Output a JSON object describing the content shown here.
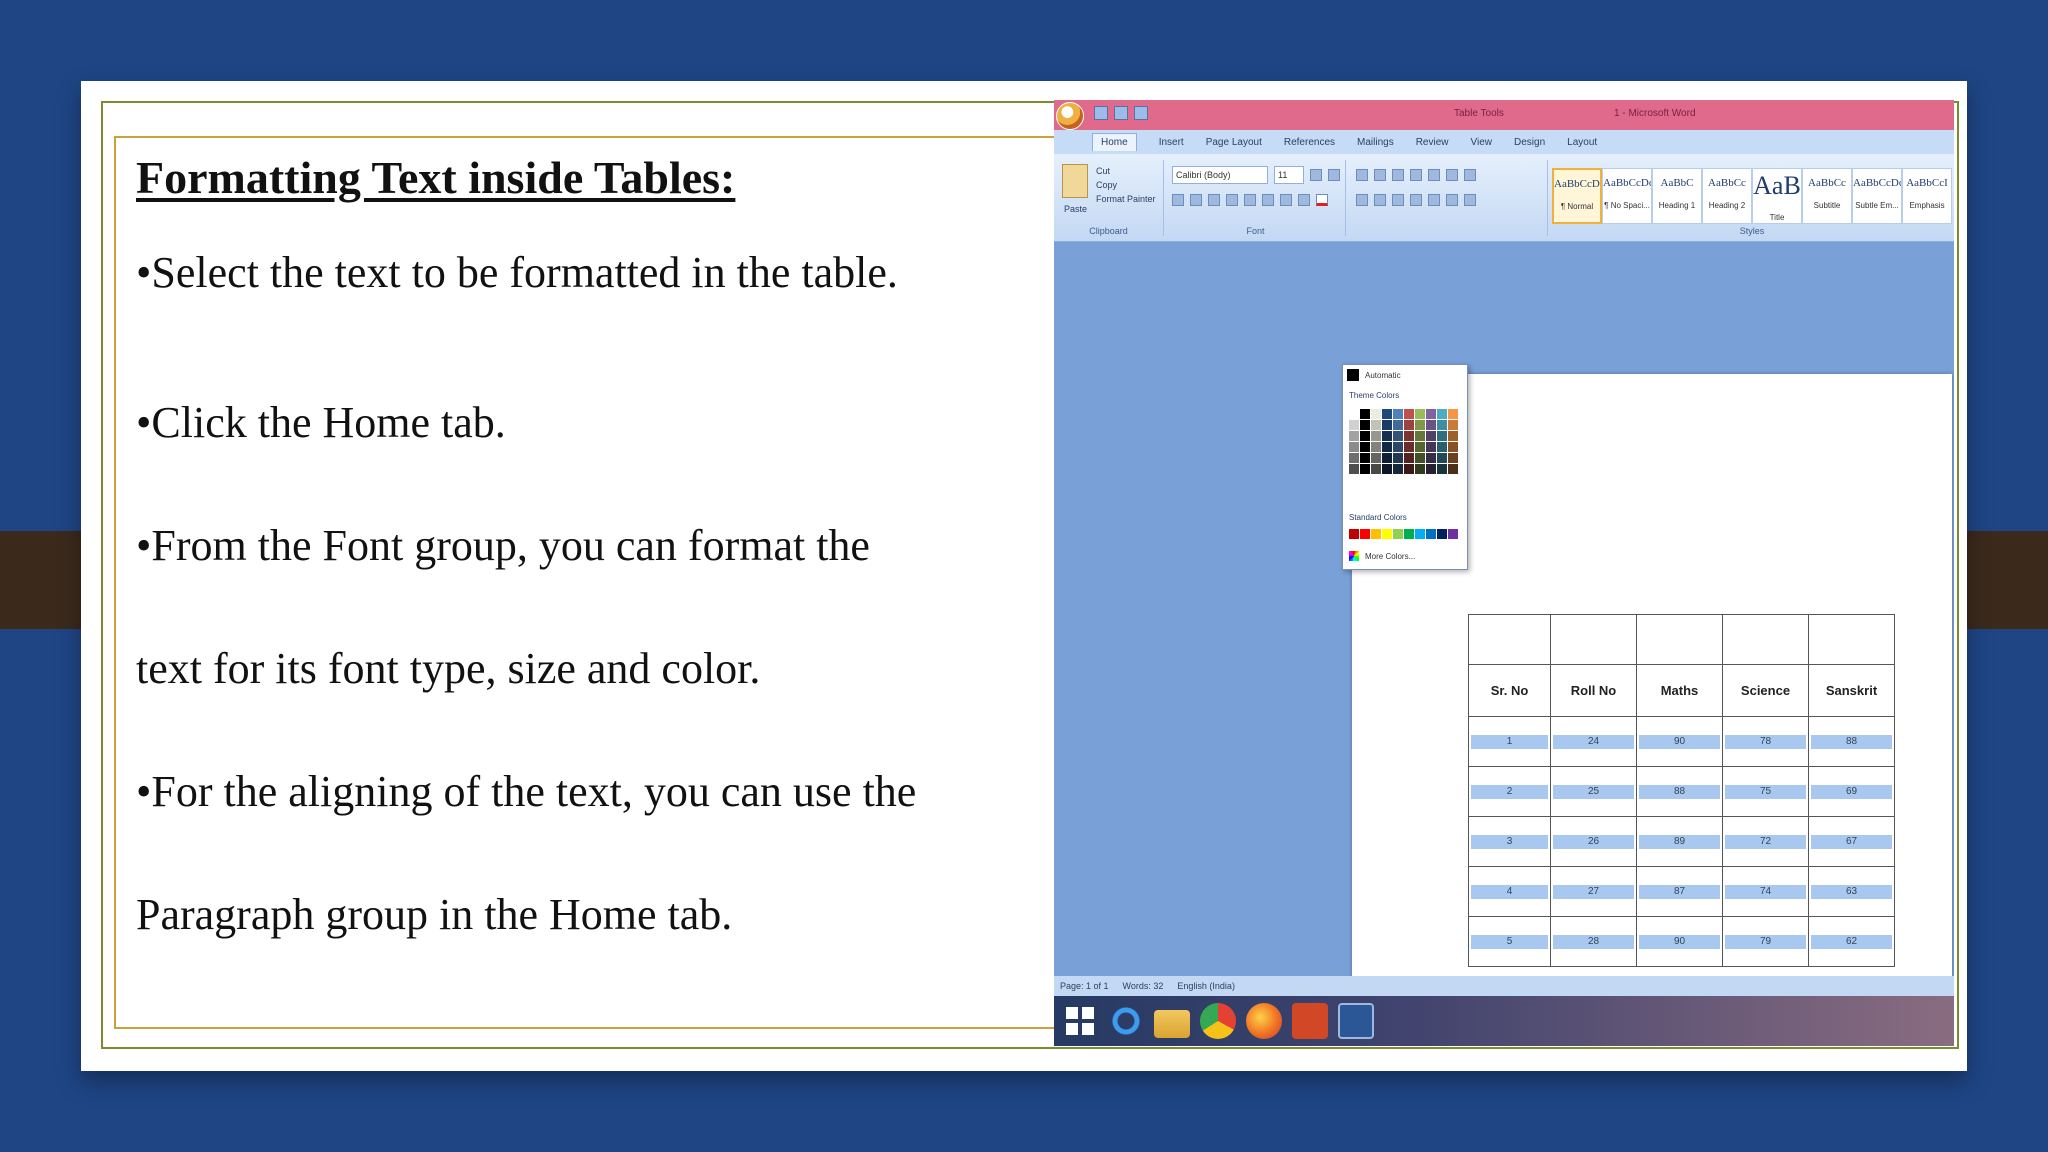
{
  "slide": {
    "heading": "Formatting Text inside Tables:",
    "bullets": [
      "•Select the text to be formatted in the table.",
      "•Click the Home tab.",
      "•From the Font group, you can format the",
      "text for its font type, size and color.",
      "•For the aligning of the text, you can use the",
      "Paragraph group in the Home tab."
    ]
  },
  "word": {
    "context_tab": "Table Tools",
    "window_title": "1 - Microsoft Word",
    "tabs": [
      "Home",
      "Insert",
      "Page Layout",
      "References",
      "Mailings",
      "Review",
      "View",
      "Design",
      "Layout"
    ],
    "active_tab": "Home",
    "clipboard": {
      "paste": "Paste",
      "cut": "Cut",
      "copy": "Copy",
      "format_painter": "Format Painter",
      "label": "Clipboard"
    },
    "font": {
      "name": "Calibri (Body)",
      "size": "11",
      "label": "Font"
    },
    "styles_label": "Styles",
    "styles": [
      {
        "sample": "AaBbCcDc",
        "name": "¶ Normal"
      },
      {
        "sample": "AaBbCcDc",
        "name": "¶ No Spaci..."
      },
      {
        "sample": "AaBbC",
        "name": "Heading 1"
      },
      {
        "sample": "AaBbCc",
        "name": "Heading 2"
      },
      {
        "sample": "AaB",
        "name": "Title"
      },
      {
        "sample": "AaBbCc",
        "name": "Subtitle"
      },
      {
        "sample": "AaBbCcDc",
        "name": "Subtle Em..."
      },
      {
        "sample": "AaBbCcI",
        "name": "Emphasis"
      }
    ],
    "palette": {
      "automatic": "Automatic",
      "theme_label": "Theme Colors",
      "standard_label": "Standard Colors",
      "more": "More Colors..."
    },
    "table": {
      "headers": [
        "Sr. No",
        "Roll No",
        "Maths",
        "Science",
        "Sanskrit"
      ],
      "rows": [
        [
          "1",
          "24",
          "90",
          "78",
          "88"
        ],
        [
          "2",
          "25",
          "88",
          "75",
          "69"
        ],
        [
          "3",
          "26",
          "89",
          "72",
          "67"
        ],
        [
          "4",
          "27",
          "87",
          "74",
          "63"
        ],
        [
          "5",
          "28",
          "90",
          "79",
          "62"
        ]
      ]
    },
    "status": {
      "page": "Page: 1 of 1",
      "words": "Words: 32",
      "language": "English (India)"
    }
  },
  "colors": {
    "background": "#1f4585",
    "frame_outer": "#7a8c2c",
    "frame_inner": "#c9a23a",
    "titlebar": "#e06a8c"
  }
}
